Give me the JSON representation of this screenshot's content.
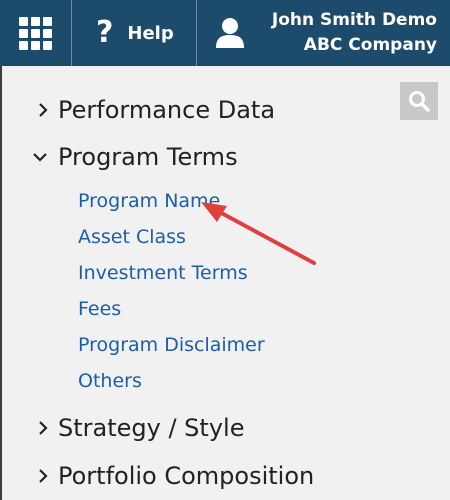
{
  "topbar": {
    "apps_icon": "apps-grid-icon",
    "help_icon": "question-mark-icon",
    "help_q": "?",
    "help_label": "Help",
    "user_icon": "user-icon",
    "user_name": "John Smith Demo",
    "company": "ABC Company",
    "color": "#1d4b6b"
  },
  "search": {
    "icon": "search-icon"
  },
  "nav": {
    "sections": [
      {
        "label": "Performance Data",
        "expanded": false
      },
      {
        "label": "Program Terms",
        "expanded": true
      },
      {
        "label": "Strategy / Style",
        "expanded": false
      },
      {
        "label": "Portfolio Composition",
        "expanded": false
      }
    ],
    "program_terms_items": [
      "Program Name",
      "Asset Class",
      "Investment Terms",
      "Fees",
      "Program Disclaimer",
      "Others"
    ],
    "link_color": "#1a5fa8"
  },
  "annotation": {
    "arrow_color": "#e0403a",
    "points_to": "Program Name"
  }
}
